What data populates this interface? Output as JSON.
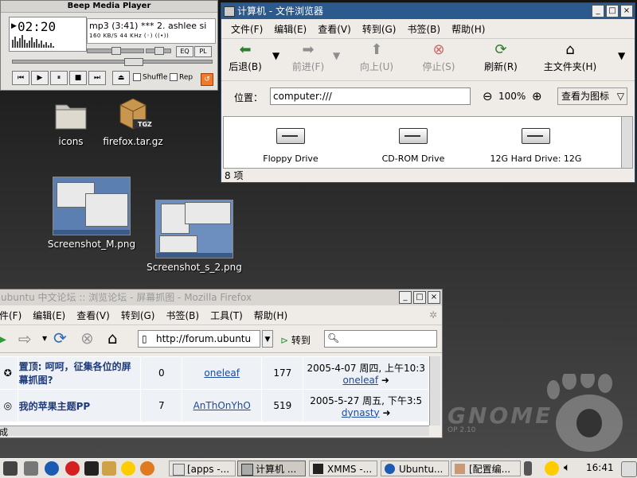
{
  "desktop": {
    "icons": [
      {
        "label": "icons"
      },
      {
        "label": "firefox.tar.gz",
        "badge": "TGZ"
      },
      {
        "label": "Screenshot_M.png"
      },
      {
        "label": "Screenshot_s_2.png"
      }
    ],
    "wallpaper_brand": "GNOME",
    "wallpaper_version": "OP 2.10"
  },
  "bmp": {
    "title": "Beep Media Player",
    "time": "02:20",
    "track": "mp3 (3:41)  ***  2. ashlee si",
    "stream_info": "160 KB/S  44 KHz    (◦)   ((•))",
    "eq_label": "EQ",
    "pl_label": "PL",
    "shuffle_label": "Shuffle",
    "repeat_label": "Rep",
    "controls": [
      "⏮",
      "▶",
      "⏸",
      "■",
      "⏭",
      "⏏"
    ]
  },
  "file_browser": {
    "title": "计算机 - 文件浏览器",
    "menu": [
      "文件(F)",
      "编辑(E)",
      "查看(V)",
      "转到(G)",
      "书签(B)",
      "帮助(H)"
    ],
    "toolbar": {
      "back": "后退(B)",
      "forward": "前进(F)",
      "up": "向上(U)",
      "stop": "停止(S)",
      "refresh": "刷新(R)",
      "home": "主文件夹(H)"
    },
    "location_label": "位置：",
    "location_value": "computer:///",
    "zoom": "100%",
    "view_as": "查看为图标",
    "items": [
      {
        "label": "Floppy Drive"
      },
      {
        "label": "CD-ROM Drive"
      },
      {
        "label": "12G Hard Drive: 12G"
      }
    ],
    "status": "8 项"
  },
  "firefox": {
    "title": "ubuntu 中文论坛 :: 浏览论坛 - 屏幕抓图 - Mozilla Firefox",
    "menu": [
      "件(F)",
      "编辑(E)",
      "查看(V)",
      "转到(G)",
      "书签(B)",
      "工具(T)",
      "帮助(H)"
    ],
    "url": "http://forum.ubuntu",
    "go_label": "转到",
    "rows": [
      {
        "topic": "置顶: 呵呵，征集各位的屏幕抓图?",
        "replies": "0",
        "author": "oneleaf",
        "views": "177",
        "last_time": "2005-4-07 周四, 上午10:3",
        "last_user": "oneleaf"
      },
      {
        "topic": "我的苹果主题PP",
        "replies": "7",
        "author": "AnThOnYhO",
        "views": "519",
        "last_time": "2005-5-27 周五, 下午3:5",
        "last_user": "dynasty"
      }
    ],
    "status": "成"
  },
  "taskbar": {
    "tasks": [
      {
        "label": "[apps -..."
      },
      {
        "label": "计算机 ..."
      },
      {
        "label": "XMMS -..."
      },
      {
        "label": "Ubuntu..."
      },
      {
        "label": "[配置编..."
      }
    ],
    "clock": "16:41"
  }
}
